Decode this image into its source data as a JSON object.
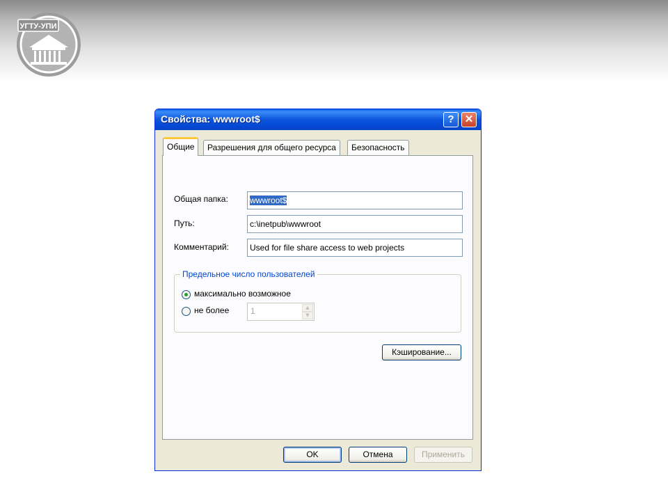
{
  "slide": {
    "logo_text": "УГТУ-УПИ"
  },
  "dialog": {
    "title": "Свойства: wwwroot$",
    "help_label": "?",
    "close_label": "✕",
    "tabs": [
      {
        "label": "Общие",
        "active": true
      },
      {
        "label": "Разрешения для общего ресурса",
        "active": false
      },
      {
        "label": "Безопасность",
        "active": false
      }
    ],
    "fields": {
      "share_name_label": "Общая папка:",
      "share_name_value": "wwwroot$",
      "path_label": "Путь:",
      "path_value": "c:\\inetpub\\wwwroot",
      "comment_label": "Комментарий:",
      "comment_value": "Used for file share access to web projects"
    },
    "user_limit": {
      "legend": "Предельное число пользователей",
      "max_label": "максимально возможное",
      "max_selected": true,
      "limit_label": "не более",
      "limit_value": "1"
    },
    "caching_button": "Кэширование...",
    "buttons": {
      "ok": "OK",
      "cancel": "Отмена",
      "apply": "Применить"
    }
  },
  "colors": {
    "titlebar": "#0c54dc",
    "legend_text": "#0046d5",
    "selection": "#316ac5",
    "dialog_bg": "#ece9d8"
  }
}
